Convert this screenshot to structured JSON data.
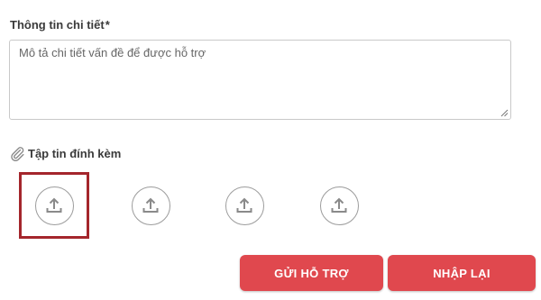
{
  "detail": {
    "label": "Thông tin chi tiết",
    "required_marker": "*",
    "placeholder": "Mô tả chi tiết vấn đề để được hỗ trợ",
    "value": ""
  },
  "attachments": {
    "label": "Tập tin đính kèm",
    "icon": "paperclip-icon",
    "slots": [
      {
        "icon": "upload-icon",
        "selected": true
      },
      {
        "icon": "upload-icon",
        "selected": false
      },
      {
        "icon": "upload-icon",
        "selected": false
      },
      {
        "icon": "upload-icon",
        "selected": false
      }
    ]
  },
  "actions": {
    "submit_label": "GỬI HỖ TRỢ",
    "reset_label": "NHẬP LẠI"
  },
  "colors": {
    "accent": "#e0484e",
    "selection_border": "#a4262c"
  }
}
